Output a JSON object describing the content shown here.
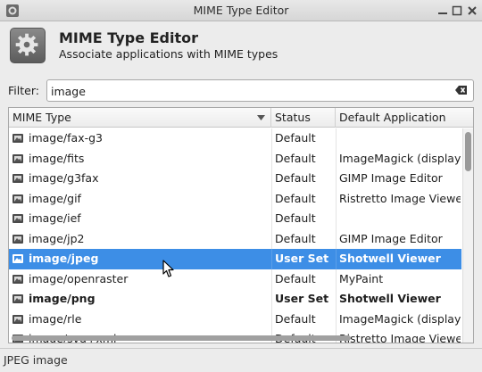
{
  "window": {
    "title": "MIME Type Editor"
  },
  "header": {
    "title": "MIME Type Editor",
    "subtitle": "Associate applications with MIME types"
  },
  "filter": {
    "label": "Filter:",
    "value": "image"
  },
  "table": {
    "columns": [
      "MIME Type",
      "Status",
      "Default Application"
    ],
    "rows": [
      {
        "mime": "image/fax-g3",
        "status": "Default",
        "app": ""
      },
      {
        "mime": "image/fits",
        "status": "Default",
        "app": "ImageMagick (display)"
      },
      {
        "mime": "image/g3fax",
        "status": "Default",
        "app": "GIMP Image Editor"
      },
      {
        "mime": "image/gif",
        "status": "Default",
        "app": "Ristretto Image Viewer"
      },
      {
        "mime": "image/ief",
        "status": "Default",
        "app": ""
      },
      {
        "mime": "image/jp2",
        "status": "Default",
        "app": "GIMP Image Editor"
      },
      {
        "mime": "image/jpeg",
        "status": "User Set",
        "app": "Shotwell Viewer",
        "selected": true
      },
      {
        "mime": "image/openraster",
        "status": "Default",
        "app": "MyPaint"
      },
      {
        "mime": "image/png",
        "status": "User Set",
        "app": "Shotwell Viewer",
        "bold": true
      },
      {
        "mime": "image/rle",
        "status": "Default",
        "app": "ImageMagick (display)"
      },
      {
        "mime": "image/svg+xml",
        "status": "Default",
        "app": "Ristretto Image Viewer"
      }
    ]
  },
  "statusbar": {
    "text": "JPEG image"
  },
  "colors": {
    "selection": "#3d8ee6",
    "background": "#ececec"
  },
  "icons": [
    "mime-editor-app-icon",
    "gear-icon",
    "clear-entry-icon",
    "file-icon",
    "sort-desc-icon",
    "mouse-cursor-icon"
  ]
}
